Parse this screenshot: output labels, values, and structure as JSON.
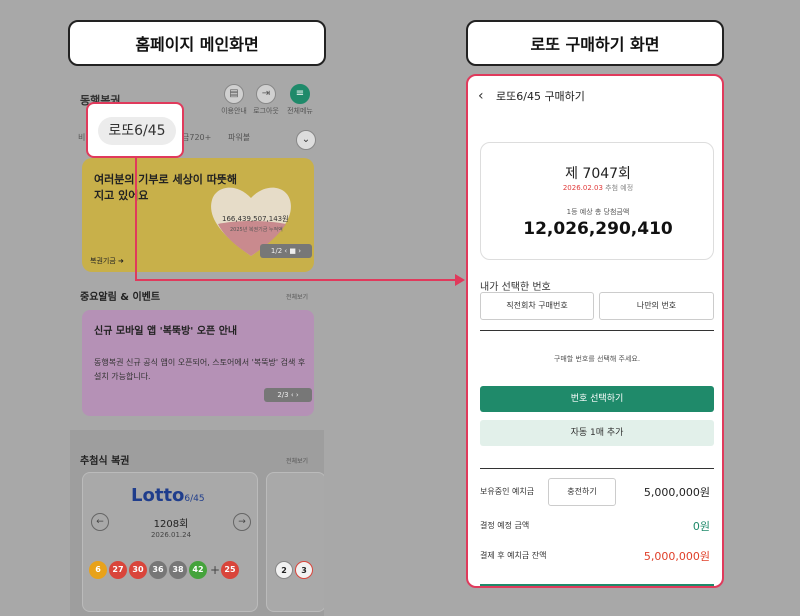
{
  "labels": {
    "left": "홈페이지 메인화면",
    "right": "로또 구매하기 화면"
  },
  "left": {
    "logo": "동행복권",
    "icons": [
      {
        "name": "book-icon",
        "label": "이용안내"
      },
      {
        "name": "logout-icon",
        "label": "로그아웃"
      },
      {
        "name": "menu-icon",
        "label": "전체메뉴"
      }
    ],
    "tabs": [
      "비",
      "금720+",
      "파워볼"
    ],
    "callout_tab": "로또6/45",
    "banner": {
      "title": "여러분의 기부로 세상이 따뜻해지고 있어요",
      "amount": "166,439,507,143원",
      "sub": "2025년 복권기금 누적액",
      "pager": "1/2 ‹ ■ ›",
      "fund_label": "복권기금"
    },
    "notice_section": {
      "title": "중요알림 & 이벤트",
      "more": "전체보기"
    },
    "event": {
      "title": "신규 모바일 앱 '복뚝방' 오픈 안내",
      "body": "동행복권 신규 공식 앱이 오픈되어, 스토어에서 '복뚝방' 검색 후 설치 가능합니다.",
      "pager": "2/3 ‹ ›"
    },
    "draw_section": {
      "title": "추첨식 복권",
      "more": "전체보기"
    },
    "lotto": {
      "logo": "Lotto",
      "logo_sub": "6/45",
      "round": "1208회",
      "date": "2026.01.24",
      "balls": [
        "6",
        "27",
        "30",
        "36",
        "38",
        "42",
        "+",
        "25"
      ],
      "ball_colors": [
        "#e8a21a",
        "#d9453b",
        "#d9453b",
        "#777777",
        "#777777",
        "#45a33c",
        "",
        "#d9453b"
      ],
      "card2_balls": [
        "2",
        "3"
      ]
    }
  },
  "right": {
    "title": "로또6/45 구매하기",
    "round": "제 7047회",
    "date": "2026.02.03",
    "date_suffix": "추첨 예정",
    "estimate_label": "1등 예상 총 당첨금액",
    "estimate_amount": "12,026,290,410",
    "select_label": "내가 선택한 번호",
    "prev_numbers": "직전회차 구매번호",
    "my_numbers": "나만의 번호",
    "hint": "구매할 번호를 선택해 주세요.",
    "select_btn": "번호 선택하기",
    "auto_btn": "자동 1매 추가",
    "deposit_label": "보유중인 예치금",
    "charge_btn": "충전하기",
    "deposit_value": "5,000,000원",
    "pay_label": "결정 예정 금액",
    "pay_value": "0원",
    "after_label": "결제 후 예치금 잔액",
    "after_value": "5,000,000원"
  },
  "colors": {
    "accent": "#e03a5c",
    "green": "#1f8a6a"
  }
}
